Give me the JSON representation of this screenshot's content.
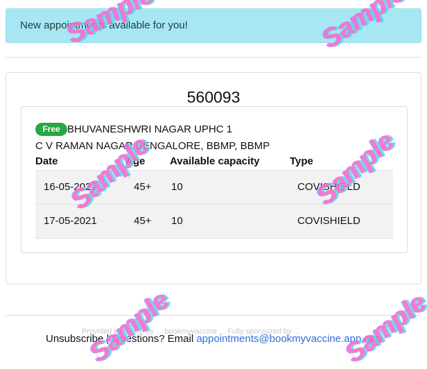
{
  "alert": {
    "text": "New appointments available for you!"
  },
  "pincode": "560093",
  "center": {
    "fee_badge": "Free",
    "name": "BHUVANESHWRI NAGAR UPHC 1",
    "address": "C V RAMAN NAGAR BENGALORE, BBMP, BBMP"
  },
  "table": {
    "headers": {
      "date": "Date",
      "age": "Age",
      "capacity": "Available capacity",
      "type": "Type"
    },
    "rows": [
      {
        "date": "16-05-2021",
        "age": "45+",
        "capacity": "10",
        "type": "COVISHIELD"
      },
      {
        "date": "17-05-2021",
        "age": "45+",
        "capacity": "10",
        "type": "COVISHIELD"
      }
    ]
  },
  "footer": {
    "unsubscribe": "Unsubscribe",
    "separator": " | ",
    "questions": "Questions? Email ",
    "email": "appointments@bookmyvaccine.app",
    "suffix": " app",
    "faint_text": "Provided with love by ... bookmyvaccine ... Fully sponsored by ..."
  },
  "watermark": {
    "text": "Sample"
  },
  "colors": {
    "alert_bg": "#a7e7f3",
    "badge_green": "#29a745",
    "link_blue": "#2f6ed8"
  }
}
